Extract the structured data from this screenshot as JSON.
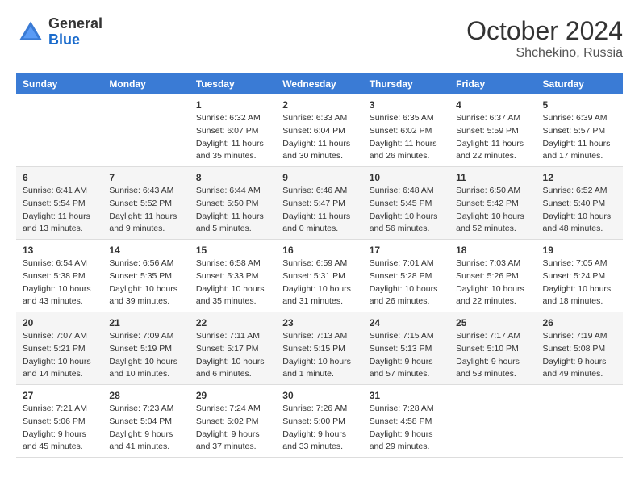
{
  "header": {
    "logo": {
      "general": "General",
      "blue": "Blue"
    },
    "title": "October 2024",
    "location": "Shchekino, Russia"
  },
  "weekdays": [
    "Sunday",
    "Monday",
    "Tuesday",
    "Wednesday",
    "Thursday",
    "Friday",
    "Saturday"
  ],
  "weeks": [
    [
      null,
      null,
      {
        "day": "1",
        "sunrise": "Sunrise: 6:32 AM",
        "sunset": "Sunset: 6:07 PM",
        "daylight": "Daylight: 11 hours and 35 minutes."
      },
      {
        "day": "2",
        "sunrise": "Sunrise: 6:33 AM",
        "sunset": "Sunset: 6:04 PM",
        "daylight": "Daylight: 11 hours and 30 minutes."
      },
      {
        "day": "3",
        "sunrise": "Sunrise: 6:35 AM",
        "sunset": "Sunset: 6:02 PM",
        "daylight": "Daylight: 11 hours and 26 minutes."
      },
      {
        "day": "4",
        "sunrise": "Sunrise: 6:37 AM",
        "sunset": "Sunset: 5:59 PM",
        "daylight": "Daylight: 11 hours and 22 minutes."
      },
      {
        "day": "5",
        "sunrise": "Sunrise: 6:39 AM",
        "sunset": "Sunset: 5:57 PM",
        "daylight": "Daylight: 11 hours and 17 minutes."
      }
    ],
    [
      {
        "day": "6",
        "sunrise": "Sunrise: 6:41 AM",
        "sunset": "Sunset: 5:54 PM",
        "daylight": "Daylight: 11 hours and 13 minutes."
      },
      {
        "day": "7",
        "sunrise": "Sunrise: 6:43 AM",
        "sunset": "Sunset: 5:52 PM",
        "daylight": "Daylight: 11 hours and 9 minutes."
      },
      {
        "day": "8",
        "sunrise": "Sunrise: 6:44 AM",
        "sunset": "Sunset: 5:50 PM",
        "daylight": "Daylight: 11 hours and 5 minutes."
      },
      {
        "day": "9",
        "sunrise": "Sunrise: 6:46 AM",
        "sunset": "Sunset: 5:47 PM",
        "daylight": "Daylight: 11 hours and 0 minutes."
      },
      {
        "day": "10",
        "sunrise": "Sunrise: 6:48 AM",
        "sunset": "Sunset: 5:45 PM",
        "daylight": "Daylight: 10 hours and 56 minutes."
      },
      {
        "day": "11",
        "sunrise": "Sunrise: 6:50 AM",
        "sunset": "Sunset: 5:42 PM",
        "daylight": "Daylight: 10 hours and 52 minutes."
      },
      {
        "day": "12",
        "sunrise": "Sunrise: 6:52 AM",
        "sunset": "Sunset: 5:40 PM",
        "daylight": "Daylight: 10 hours and 48 minutes."
      }
    ],
    [
      {
        "day": "13",
        "sunrise": "Sunrise: 6:54 AM",
        "sunset": "Sunset: 5:38 PM",
        "daylight": "Daylight: 10 hours and 43 minutes."
      },
      {
        "day": "14",
        "sunrise": "Sunrise: 6:56 AM",
        "sunset": "Sunset: 5:35 PM",
        "daylight": "Daylight: 10 hours and 39 minutes."
      },
      {
        "day": "15",
        "sunrise": "Sunrise: 6:58 AM",
        "sunset": "Sunset: 5:33 PM",
        "daylight": "Daylight: 10 hours and 35 minutes."
      },
      {
        "day": "16",
        "sunrise": "Sunrise: 6:59 AM",
        "sunset": "Sunset: 5:31 PM",
        "daylight": "Daylight: 10 hours and 31 minutes."
      },
      {
        "day": "17",
        "sunrise": "Sunrise: 7:01 AM",
        "sunset": "Sunset: 5:28 PM",
        "daylight": "Daylight: 10 hours and 26 minutes."
      },
      {
        "day": "18",
        "sunrise": "Sunrise: 7:03 AM",
        "sunset": "Sunset: 5:26 PM",
        "daylight": "Daylight: 10 hours and 22 minutes."
      },
      {
        "day": "19",
        "sunrise": "Sunrise: 7:05 AM",
        "sunset": "Sunset: 5:24 PM",
        "daylight": "Daylight: 10 hours and 18 minutes."
      }
    ],
    [
      {
        "day": "20",
        "sunrise": "Sunrise: 7:07 AM",
        "sunset": "Sunset: 5:21 PM",
        "daylight": "Daylight: 10 hours and 14 minutes."
      },
      {
        "day": "21",
        "sunrise": "Sunrise: 7:09 AM",
        "sunset": "Sunset: 5:19 PM",
        "daylight": "Daylight: 10 hours and 10 minutes."
      },
      {
        "day": "22",
        "sunrise": "Sunrise: 7:11 AM",
        "sunset": "Sunset: 5:17 PM",
        "daylight": "Daylight: 10 hours and 6 minutes."
      },
      {
        "day": "23",
        "sunrise": "Sunrise: 7:13 AM",
        "sunset": "Sunset: 5:15 PM",
        "daylight": "Daylight: 10 hours and 1 minute."
      },
      {
        "day": "24",
        "sunrise": "Sunrise: 7:15 AM",
        "sunset": "Sunset: 5:13 PM",
        "daylight": "Daylight: 9 hours and 57 minutes."
      },
      {
        "day": "25",
        "sunrise": "Sunrise: 7:17 AM",
        "sunset": "Sunset: 5:10 PM",
        "daylight": "Daylight: 9 hours and 53 minutes."
      },
      {
        "day": "26",
        "sunrise": "Sunrise: 7:19 AM",
        "sunset": "Sunset: 5:08 PM",
        "daylight": "Daylight: 9 hours and 49 minutes."
      }
    ],
    [
      {
        "day": "27",
        "sunrise": "Sunrise: 7:21 AM",
        "sunset": "Sunset: 5:06 PM",
        "daylight": "Daylight: 9 hours and 45 minutes."
      },
      {
        "day": "28",
        "sunrise": "Sunrise: 7:23 AM",
        "sunset": "Sunset: 5:04 PM",
        "daylight": "Daylight: 9 hours and 41 minutes."
      },
      {
        "day": "29",
        "sunrise": "Sunrise: 7:24 AM",
        "sunset": "Sunset: 5:02 PM",
        "daylight": "Daylight: 9 hours and 37 minutes."
      },
      {
        "day": "30",
        "sunrise": "Sunrise: 7:26 AM",
        "sunset": "Sunset: 5:00 PM",
        "daylight": "Daylight: 9 hours and 33 minutes."
      },
      {
        "day": "31",
        "sunrise": "Sunrise: 7:28 AM",
        "sunset": "Sunset: 4:58 PM",
        "daylight": "Daylight: 9 hours and 29 minutes."
      },
      null,
      null
    ]
  ]
}
